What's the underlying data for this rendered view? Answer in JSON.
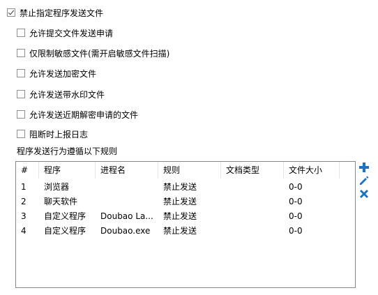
{
  "options": [
    {
      "label": "禁止指定程序发送文件",
      "checked": true
    },
    {
      "label": "允许提交文件发送申请",
      "checked": false
    },
    {
      "label": "仅限制敏感文件(需开启敏感文件扫描)",
      "checked": false
    },
    {
      "label": "允许发送加密文件",
      "checked": false
    },
    {
      "label": "允许发送带水印文件",
      "checked": false
    },
    {
      "label": "允许发送近期解密申请的文件",
      "checked": false
    },
    {
      "label": "阻断时上报日志",
      "checked": false
    }
  ],
  "rules_label": "程序发送行为遵循以下规则",
  "table": {
    "columns": [
      "#",
      "程序",
      "进程名",
      "规则",
      "文档类型",
      "文件大小"
    ],
    "rows": [
      [
        "1",
        "浏览器",
        "",
        "禁止发送",
        "",
        "0-0"
      ],
      [
        "2",
        "聊天软件",
        "",
        "禁止发送",
        "",
        "0-0"
      ],
      [
        "3",
        "自定义程序",
        "Doubao La...",
        "禁止发送",
        "",
        "0-0"
      ],
      [
        "4",
        "自定义程序",
        "Doubao.exe",
        "禁止发送",
        "",
        "0-0"
      ]
    ]
  },
  "actions": [
    {
      "name": "add-rule-button",
      "icon": "plus-icon",
      "color": "#1a73c8"
    },
    {
      "name": "edit-rule-button",
      "icon": "pencil-icon",
      "color": "#1a73c8"
    },
    {
      "name": "delete-rule-button",
      "icon": "close-icon",
      "color": "#1a73c8"
    }
  ]
}
